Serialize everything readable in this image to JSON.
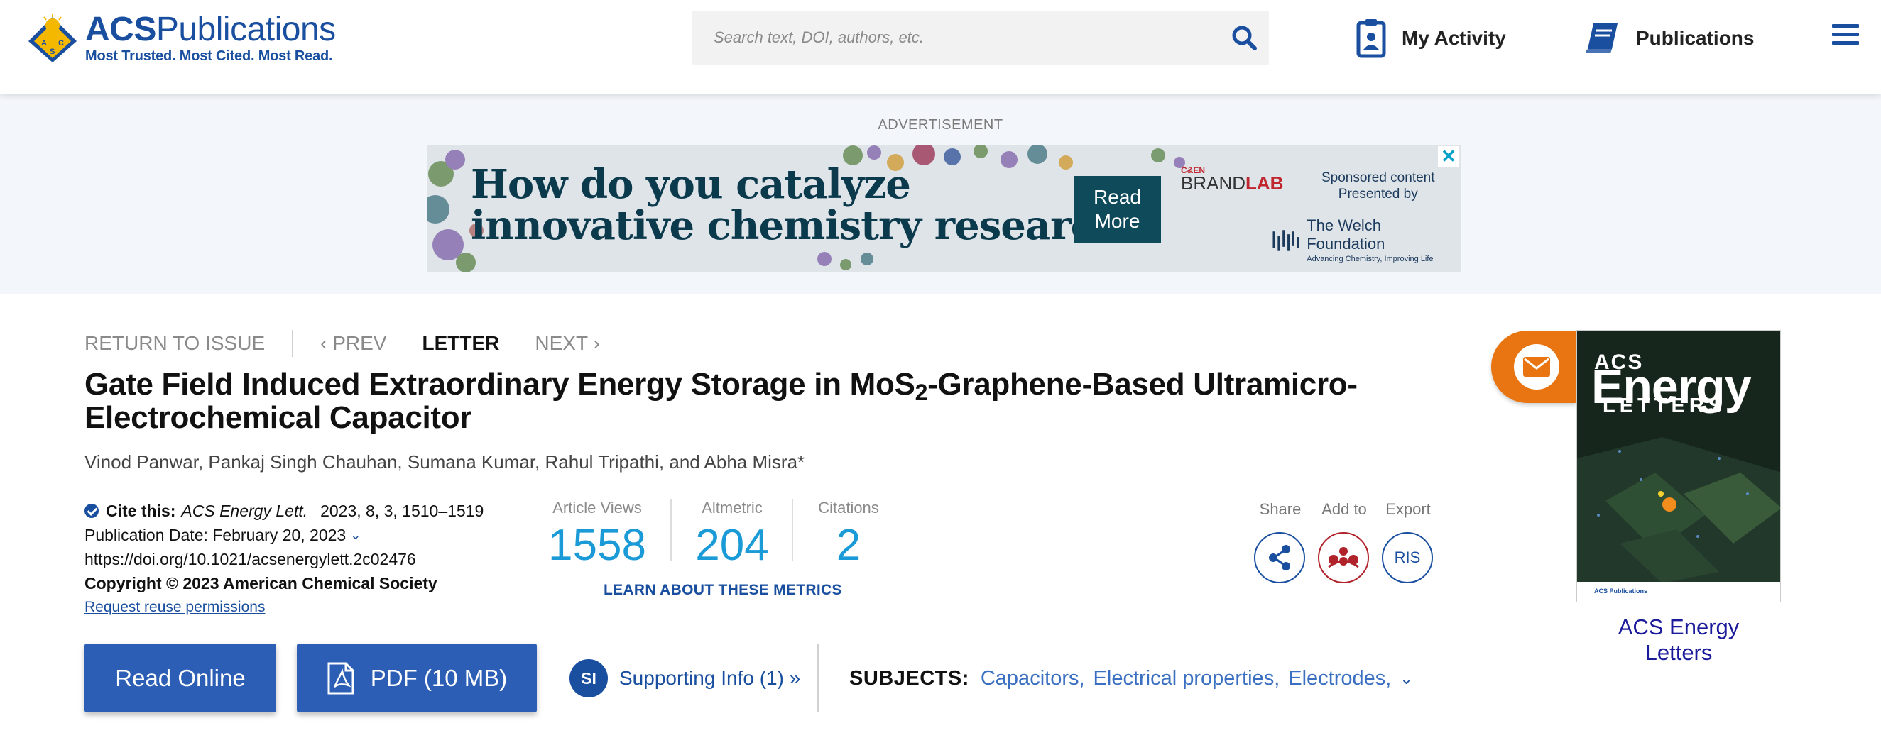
{
  "header": {
    "logo_title_bold": "ACS",
    "logo_title_rest": "Publications",
    "logo_tagline": "Most Trusted. Most Cited. Most Read.",
    "search_placeholder": "Search text, DOI, authors, etc.",
    "nav": {
      "activity": "My Activity",
      "publications": "Publications"
    },
    "icons": [
      "acs-diamond-logo-icon",
      "search-icon",
      "clipboard-icon",
      "book-icon",
      "hamburger-menu-icon"
    ],
    "accent_color": "#1a4fa0"
  },
  "ad": {
    "label": "ADVERTISEMENT",
    "headline_line1": "How do you catalyze",
    "headline_line2": "innovative chemistry research?",
    "cta_line1": "Read",
    "cta_line2": "More",
    "brand_cen": "C&EN",
    "brand_main": "BRAND",
    "brand_lab": "LAB",
    "sponsor_line1": "Sponsored content",
    "sponsor_line2": "Presented by",
    "welch_name": "The Welch Foundation",
    "welch_sub": "Advancing Chemistry, Improving Life",
    "close": "✕"
  },
  "article_nav": {
    "return": "RETURN TO ISSUE",
    "prev": "‹ PREV",
    "type": "LETTER",
    "next": "NEXT ›"
  },
  "article": {
    "title_part1": "Gate Field Induced Extraordinary Energy Storage in MoS",
    "title_sub": "2",
    "title_part2": "-Graphene-Based Ultramicro-Electrochemical Capacitor",
    "authors": "Vinod Panwar, Pankaj Singh Chauhan, Sumana Kumar, Rahul Tripathi, and Abha Misra*",
    "cite_label": "Cite this:",
    "cite_journal": "ACS Energy Lett.",
    "cite_ref": "2023, 8, 3, 1510–1519",
    "pub_date": "Publication Date: February 20, 2023",
    "doi": "https://doi.org/10.1021/acsenergylett.2c02476",
    "copyright": "Copyright © 2023 American Chemical Society",
    "reuse": "Request reuse permissions"
  },
  "metrics": {
    "views_label": "Article Views",
    "views": "1558",
    "altmetric_label": "Altmetric",
    "altmetric": "204",
    "citations_label": "Citations",
    "citations": "2",
    "learn": "LEARN ABOUT THESE METRICS"
  },
  "actions": {
    "share": "Share",
    "add": "Add to",
    "export": "Export",
    "ris": "RIS"
  },
  "buttons": {
    "read_online": "Read Online",
    "pdf": "PDF (10 MB)",
    "si_badge": "SI",
    "supporting": "Supporting Info (1) »"
  },
  "subjects": {
    "label": "SUBJECTS:",
    "items": [
      "Capacitors,",
      "Electrical properties,",
      "Electrodes,"
    ]
  },
  "cover": {
    "acs": "ACS",
    "energy": "Energy",
    "letters": "LETTERS",
    "footer": "ACS Publications",
    "journal_link": "ACS Energy Letters"
  }
}
